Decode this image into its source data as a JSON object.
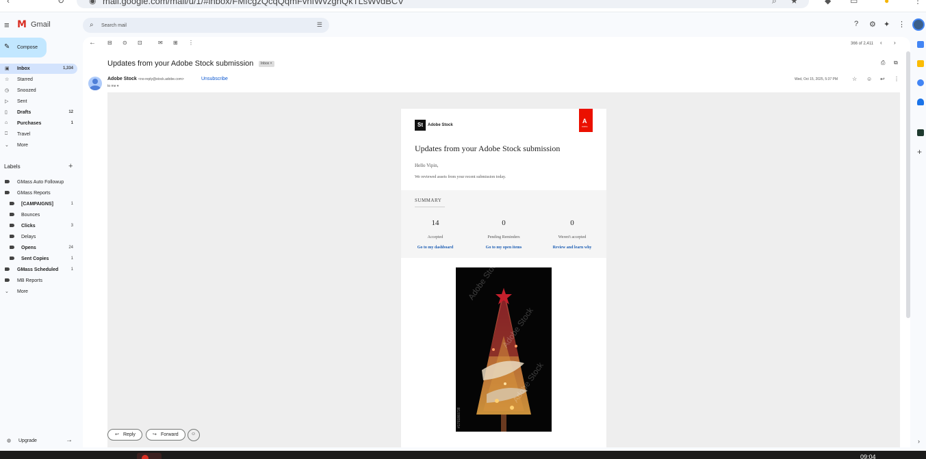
{
  "browser": {
    "url": "mail.google.com/mail/u/1/#inbox/FMfcgzQcqQqmFvnfWvzgnQkTLsWvdBCV"
  },
  "app": {
    "name": "Gmail",
    "logo_glyph": "M"
  },
  "search": {
    "placeholder": "Search mail"
  },
  "sidebar": {
    "compose_label": "Compose",
    "items": [
      {
        "label": "Inbox",
        "count": "1,334",
        "icon": "inbox-icon",
        "glyph": "▣",
        "bold": true,
        "active": true
      },
      {
        "label": "Starred",
        "count": "",
        "icon": "star-icon",
        "glyph": "☆",
        "bold": false,
        "active": false
      },
      {
        "label": "Snoozed",
        "count": "",
        "icon": "clock-icon",
        "glyph": "◷",
        "bold": false,
        "active": false
      },
      {
        "label": "Sent",
        "count": "",
        "icon": "send-icon",
        "glyph": "▷",
        "bold": false,
        "active": false
      },
      {
        "label": "Drafts",
        "count": "12",
        "icon": "draft-icon",
        "glyph": "▯",
        "bold": true,
        "active": false
      },
      {
        "label": "Purchases",
        "count": "1",
        "icon": "bag-icon",
        "glyph": "⌂",
        "bold": true,
        "active": false
      },
      {
        "label": "Travel",
        "count": "",
        "icon": "luggage-icon",
        "glyph": "⎕",
        "bold": false,
        "active": false
      },
      {
        "label": "More",
        "count": "",
        "icon": "chevron-down-icon",
        "glyph": "⌄",
        "bold": false,
        "active": false
      }
    ],
    "labels_title": "Labels",
    "labels": [
      {
        "label": "GMass Auto Followup",
        "count": "",
        "bold": false,
        "indent": false
      },
      {
        "label": "GMass Reports",
        "count": "",
        "bold": false,
        "indent": false
      },
      {
        "label": "[CAMPAIGNS]",
        "count": "1",
        "bold": true,
        "indent": true
      },
      {
        "label": "Bounces",
        "count": "",
        "bold": false,
        "indent": true
      },
      {
        "label": "Clicks",
        "count": "3",
        "bold": true,
        "indent": true
      },
      {
        "label": "Delays",
        "count": "",
        "bold": false,
        "indent": true
      },
      {
        "label": "Opens",
        "count": "24",
        "bold": true,
        "indent": true
      },
      {
        "label": "Sent Copies",
        "count": "1",
        "bold": true,
        "indent": true
      },
      {
        "label": "GMass Scheduled",
        "count": "1",
        "bold": true,
        "indent": false
      },
      {
        "label": "MB Reports",
        "count": "",
        "bold": false,
        "indent": false
      }
    ],
    "labels_more": "More",
    "upgrade_label": "Upgrade"
  },
  "toolbar": {
    "pager_text": "366 of 2,411"
  },
  "message": {
    "subject": "Updates from your Adobe Stock submission",
    "label_chip": "Inbox ×",
    "sender_name": "Adobe Stock",
    "sender_email": "<no-reply@stock.adobe.com>",
    "unsubscribe": "Unsubscribe",
    "to_me": "to me ▾",
    "date": "Wed, Oct 15, 2025, 5:37 PM"
  },
  "email_card": {
    "brand_badge": "St",
    "brand_name": "Adobe Stock",
    "adobe_glyph": "A",
    "adobe_word": "Adobe",
    "title": "Updates from your Adobe Stock submission",
    "greeting": "Hello Vipin,",
    "intro": "We reviewed assets from your recent submission today.",
    "summary_title": "SUMMARY",
    "stats": [
      {
        "value": "14",
        "label": "Accepted",
        "link": "Go to my dashboard"
      },
      {
        "value": "0",
        "label": "Pending Reminders",
        "link": "Go to my open items"
      },
      {
        "value": "0",
        "label": "Weren't accepted",
        "link": "Review and learn why"
      }
    ],
    "watermark": "Adobe Stock",
    "image_id": "#1791860738"
  },
  "actions": {
    "reply_label": "Reply",
    "forward_label": "Forward"
  },
  "taskbar": {
    "clock": "09:04"
  },
  "colors": {
    "accent": "#0b57d0",
    "compose_bg": "#c2e7ff",
    "active_nav": "#d3e3fd",
    "adobe_red": "#eb1000"
  }
}
